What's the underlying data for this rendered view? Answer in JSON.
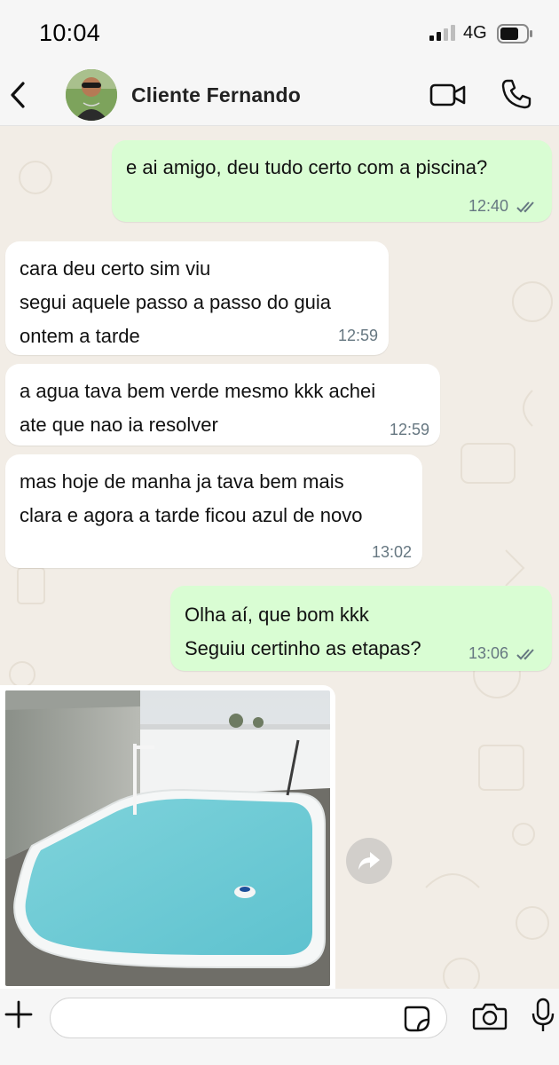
{
  "status_bar": {
    "time": "10:04",
    "network": "4G"
  },
  "header": {
    "contact_name": "Cliente Fernando",
    "icons": [
      "back-icon",
      "video-call-icon",
      "phone-icon"
    ]
  },
  "messages": [
    {
      "direction": "out",
      "lines": [
        "e ai amigo, deu tudo certo com a piscina?"
      ],
      "time": "12:40",
      "read": true
    },
    {
      "direction": "in",
      "lines": [
        "cara deu certo sim viu",
        "segui aquele passo a passo do guia",
        "ontem a tarde"
      ],
      "time": "12:59"
    },
    {
      "direction": "in",
      "lines": [
        "a agua tava bem verde mesmo kkk achei",
        "ate que nao ia resolver"
      ],
      "time": "12:59"
    },
    {
      "direction": "in",
      "lines": [
        "mas hoje de manha ja tava bem mais",
        "clara e agora a tarde ficou azul de novo"
      ],
      "time": "13:02"
    },
    {
      "direction": "out",
      "lines": [
        "Olha aí, que bom kkk",
        "Seguiu certinho as etapas?"
      ],
      "time": "13:06",
      "read": true
    }
  ],
  "image_message": {
    "icon": "forward-icon"
  },
  "input_bar": {
    "placeholder": "",
    "icons": [
      "plus-icon",
      "sticker-icon",
      "camera-icon",
      "mic-icon"
    ]
  },
  "colors": {
    "outgoing_bubble": "#d9fdd3",
    "incoming_bubble": "#ffffff",
    "read_ticks": "#667781",
    "background": "#efeae2"
  }
}
